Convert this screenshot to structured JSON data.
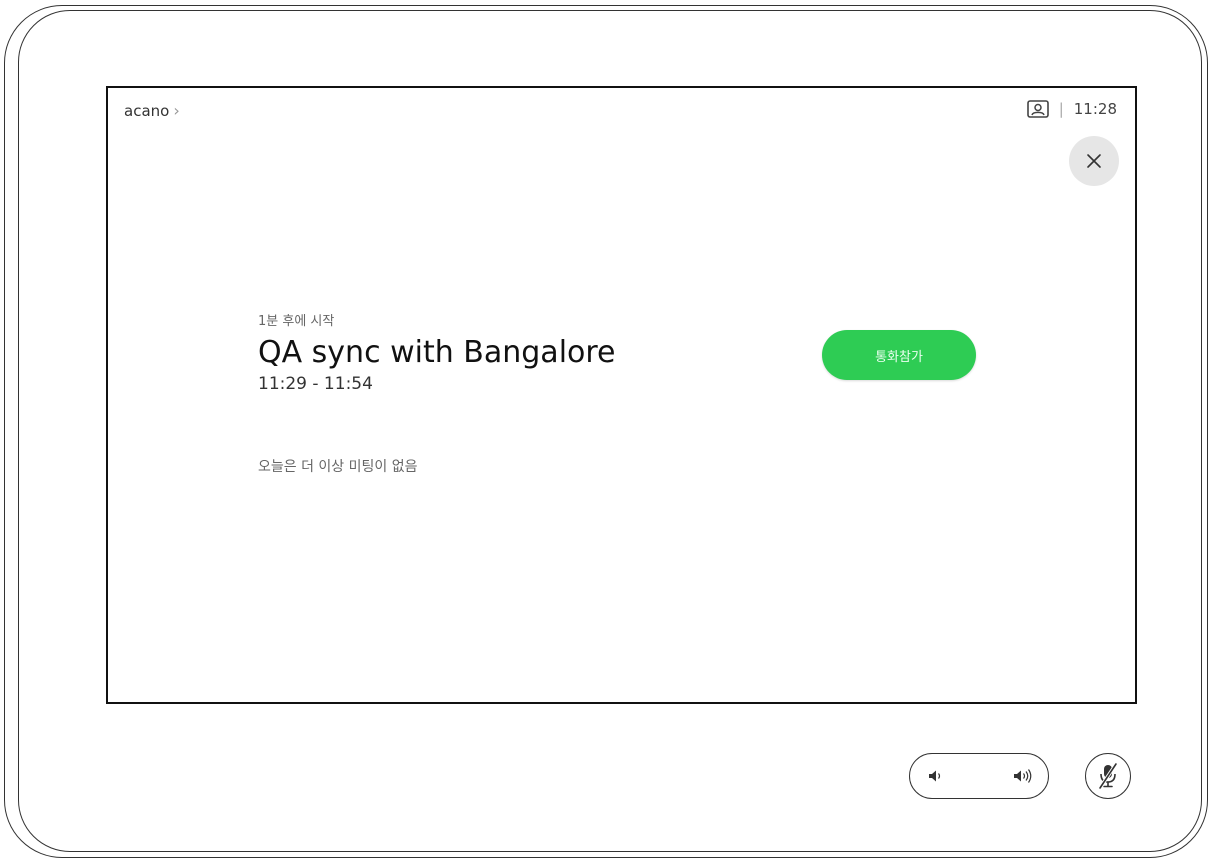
{
  "header": {
    "device_name": "acano",
    "chevron": "›",
    "separator": "|",
    "time": "11:28",
    "selfview_icon": "selfview-icon"
  },
  "close_icon": "close-icon",
  "meeting": {
    "starts_in": "1분 후에 시작",
    "title": "QA sync with Bangalore",
    "time_range": "11:29 - 11:54",
    "join_label": "통화참가"
  },
  "no_more_meetings": "오늘은 더 이상 미팅이 없음",
  "controls": {
    "volume_down_icon": "volume-down-icon",
    "volume_up_icon": "volume-up-icon",
    "mute_icon": "microphone-muted-icon"
  },
  "colors": {
    "join_button": "#2ecc54",
    "close_button_bg": "#e6e6e6"
  }
}
